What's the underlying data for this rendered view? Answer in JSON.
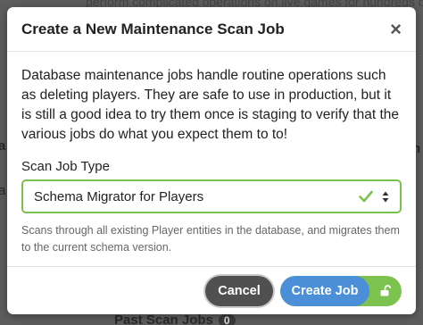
{
  "background": {
    "top_text": "perform complicated operations on live games for hundreds of",
    "left_fragment_a": "a",
    "left_fragment_b": "a",
    "right_fragment": "h",
    "past_scan_jobs_label": "Past Scan Jobs",
    "past_scan_jobs_count": "0"
  },
  "modal": {
    "title": "Create a New Maintenance Scan Job",
    "close_label": "×",
    "description": "Database maintenance jobs handle routine operations such as deleting players. They are safe to use in production, but it is still a good idea to try them once is staging to verify that the various jobs do what you expect them to to!",
    "scan_job_type_label": "Scan Job Type",
    "scan_job_type_value": "Schema Migrator for Players",
    "help_text": "Scans through all existing Player entities in the database, and migrates them to the current schema version.",
    "cancel_label": "Cancel",
    "create_label": "Create Job"
  },
  "colors": {
    "valid_green": "#7cc24f",
    "primary_blue": "#4a8fd8",
    "cancel_gray": "#505050"
  },
  "icons": {
    "close": "close-icon",
    "valid": "check-icon",
    "select_arrows": "updown-icon",
    "unlocked": "unlock-icon"
  }
}
